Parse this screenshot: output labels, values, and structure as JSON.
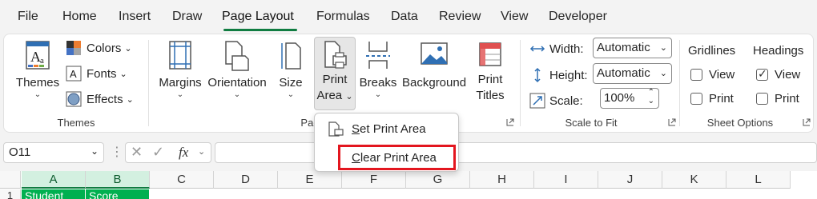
{
  "menu": {
    "tabs": [
      "File",
      "Home",
      "Insert",
      "Draw",
      "Page Layout",
      "Formulas",
      "Data",
      "Review",
      "View",
      "Developer"
    ],
    "active": "Page Layout"
  },
  "ribbon": {
    "themes_group": {
      "themes_label": "Themes",
      "colors_label": "Colors",
      "fonts_label": "Fonts",
      "effects_label": "Effects",
      "group_label": "Themes"
    },
    "page_setup_group": {
      "margins_label": "Margins",
      "orientation_label": "Orientation",
      "size_label": "Size",
      "print_area_label_1": "Print",
      "print_area_label_2": "Area",
      "breaks_label": "Breaks",
      "background_label": "Background",
      "print_titles_label_1": "Print",
      "print_titles_label_2": "Titles",
      "group_label_partial": "Pag"
    },
    "scale_group": {
      "width_label": "Width:",
      "width_value": "Automatic",
      "height_label": "Height:",
      "height_value": "Automatic",
      "scale_label": "Scale:",
      "scale_value": "100%",
      "group_label": "Scale to Fit"
    },
    "sheet_options_group": {
      "gridlines_label": "Gridlines",
      "headings_label": "Headings",
      "gridlines_view": "View",
      "gridlines_print": "Print",
      "headings_view": "View",
      "headings_print": "Print",
      "gridlines_view_checked": false,
      "gridlines_print_checked": false,
      "headings_view_checked": true,
      "headings_print_checked": false,
      "group_label": "Sheet Options"
    }
  },
  "dropdown": {
    "set_print_area": {
      "mnemonic": "S",
      "rest": "et Print Area"
    },
    "clear_print_area": {
      "mnemonic": "C",
      "rest": "lear Print Area"
    }
  },
  "formula_bar": {
    "name_box": "O11",
    "fx": "fx"
  },
  "grid": {
    "columns": [
      "A",
      "B",
      "C",
      "D",
      "E",
      "F",
      "G",
      "H",
      "I",
      "J",
      "K",
      "L"
    ],
    "row_number": "1",
    "cells": {
      "A1": "Student",
      "B1": "Score"
    }
  },
  "colors": {
    "accent": "#107c41",
    "highlight_red": "#e3161f",
    "header_fill": "#00b050"
  }
}
